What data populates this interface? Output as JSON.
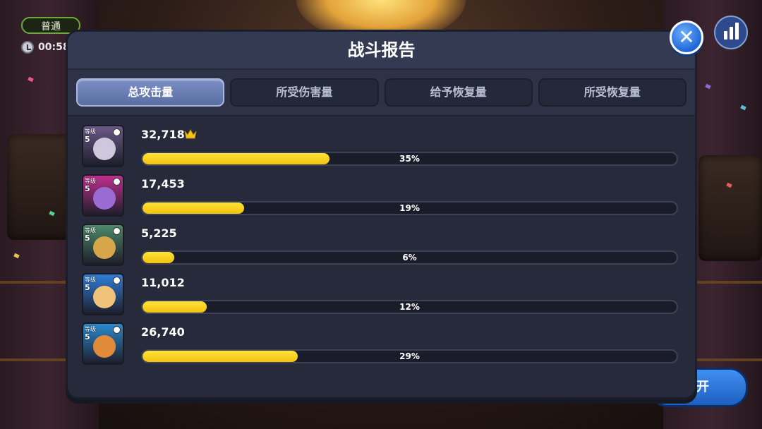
{
  "hud": {
    "mode_label": "普通",
    "timer_text": "00:58",
    "close_icon": "close-icon",
    "stats_icon": "bar-chart-icon",
    "leave_button_label": "开"
  },
  "dialog": {
    "title": "战斗报告",
    "tabs": [
      {
        "label": "总攻击量",
        "active": true
      },
      {
        "label": "所受伤害量",
        "active": false
      },
      {
        "label": "给予恢复量",
        "active": false
      },
      {
        "label": "所受恢复量",
        "active": false
      }
    ],
    "rows": [
      {
        "level_label": "等级",
        "level": "5",
        "value": "32,718",
        "percent_text": "35%",
        "fraction": 0.35,
        "top": true,
        "color": "#6b5a8a",
        "face": "#cfc8dc"
      },
      {
        "level_label": "等级",
        "level": "5",
        "value": "17,453",
        "percent_text": "19%",
        "fraction": 0.19,
        "top": false,
        "color": "#c02f8f",
        "face": "#9a6bd0"
      },
      {
        "level_label": "等级",
        "level": "5",
        "value": "5,225",
        "percent_text": "6%",
        "fraction": 0.06,
        "top": false,
        "color": "#4d8a6a",
        "face": "#d8a64a"
      },
      {
        "level_label": "等级",
        "level": "5",
        "value": "11,012",
        "percent_text": "12%",
        "fraction": 0.12,
        "top": false,
        "color": "#2f7ed8",
        "face": "#f0c27a"
      },
      {
        "level_label": "等级",
        "level": "5",
        "value": "26,740",
        "percent_text": "29%",
        "fraction": 0.29,
        "top": false,
        "color": "#2a8ad0",
        "face": "#e08a3a"
      }
    ],
    "crown_icon": "crown-icon"
  },
  "colors": {
    "bar_fill": "#f2c20c",
    "dialog_bg": "#2d3246",
    "active_tab": "#6a7eb4",
    "close_button": "#1e66d6"
  }
}
